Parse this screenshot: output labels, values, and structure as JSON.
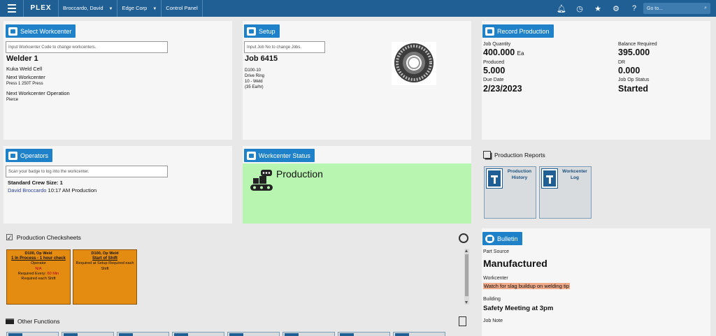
{
  "topbar": {
    "logo": "PLEX",
    "user": "Broccardo, David",
    "company": "Edge Corp",
    "panel": "Control Panel",
    "goto_placeholder": "Go to..."
  },
  "workcenter": {
    "header": "Select Workcenter",
    "input_placeholder": "Input Workcenter Code to change workcenters.",
    "name": "Welder 1",
    "cell": "Kuka Weld Cell",
    "next_label": "Next Workcenter",
    "next_value": "Press 1 250T Press",
    "next_op_label": "Next Workcenter Operation",
    "next_op_value": "Pierce"
  },
  "setup": {
    "header": "Setup",
    "input_placeholder": "Input Job No to change Jobs.",
    "job": "Job 6415",
    "lines": [
      "D100-10",
      "Drive Ring",
      "10 - Weld",
      "(35 Ea/hr)"
    ]
  },
  "record_production": {
    "header": "Record Production",
    "job_quantity_label": "Job Quantity",
    "job_quantity": "400.000",
    "job_quantity_unit": "Ea",
    "balance_label": "Balance Required",
    "balance": "395.000",
    "produced_label": "Produced",
    "produced": "5.000",
    "dr_label": "DR",
    "dr": "0.000",
    "due_label": "Due Date",
    "due": "2/23/2023",
    "status_label": "Job Op Status",
    "status": "Started"
  },
  "operators": {
    "header": "Operators",
    "input_placeholder": "Scan your badge to log into the workcenter.",
    "crew_size": "Standard Crew Size: 1",
    "operator_name": "David Broccardo",
    "operator_detail": "10:17 AM Production"
  },
  "workcenter_status": {
    "header": "Workcenter Status",
    "status": "Production",
    "color": "#b8f5b0"
  },
  "production_reports": {
    "header": "Production Reports",
    "tiles": [
      {
        "label": "Production History"
      },
      {
        "label": "Workcenter Log"
      }
    ]
  },
  "checksheets": {
    "header": "Production Checksheets",
    "items": [
      {
        "title": "D100, Op Weld",
        "name": "1 In Process - 1 hour check",
        "line3": "Operator",
        "line4": "N/A",
        "line5_label": "Required Every:",
        "line5_value": "60 Min",
        "line6": "Required each Shift"
      },
      {
        "title": "D100, Op Weld",
        "name": "Start of Shift",
        "line3": "Required at Setup Required each Shift"
      }
    ]
  },
  "other_functions": {
    "header": "Other Functions"
  },
  "bulletin": {
    "header": "Bulletin",
    "part_source_label": "Part Source",
    "part_source": "Manufactured",
    "workcenter_label": "Workcenter",
    "workcenter_note": "Watch for slag buildup on welding tip",
    "building_label": "Building",
    "building_note": "Safety Meeting at 3pm",
    "job_note_label": "Job Note"
  }
}
